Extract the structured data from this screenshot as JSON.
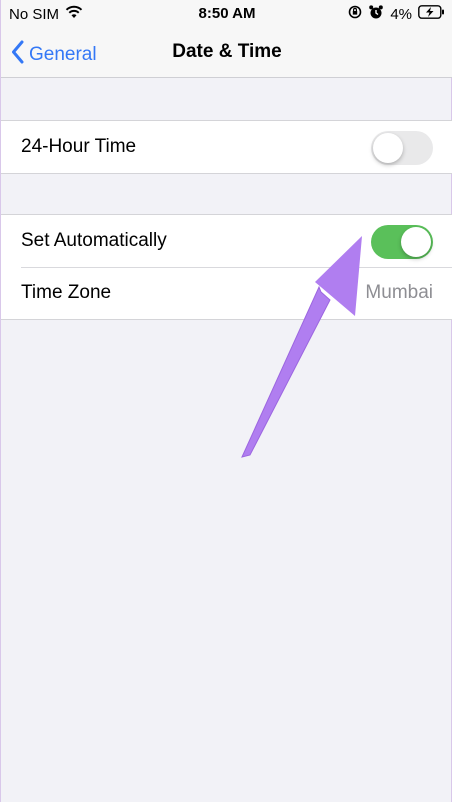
{
  "status_bar": {
    "carrier": "No SIM",
    "time": "8:50 AM",
    "battery": "4%",
    "icons": [
      "wifi-icon",
      "orientation-lock-icon",
      "alarm-icon",
      "battery-charging-icon"
    ]
  },
  "nav": {
    "back_label": "General",
    "title": "Date & Time"
  },
  "settings": {
    "hour_24": {
      "label": "24-Hour Time",
      "enabled": false
    },
    "set_automatically": {
      "label": "Set Automatically",
      "enabled": true
    },
    "time_zone": {
      "label": "Time Zone",
      "value": "Mumbai"
    }
  },
  "colors": {
    "accent": "#3478f6",
    "toggle_on": "#5ac05a",
    "toggle_off": "#e9e9ea",
    "annotation_arrow": "#b07ef0",
    "background": "#f2f2f7"
  }
}
